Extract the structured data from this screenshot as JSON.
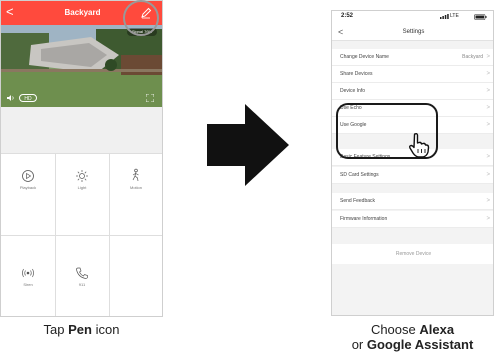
{
  "left_phone": {
    "title": "Backyard",
    "back_glyph": "<",
    "wifi_badge": "Signal 76%",
    "hd_label": "HD",
    "controls": [
      {
        "label": "Playback",
        "icon": "playback-icon"
      },
      {
        "label": "Light",
        "icon": "light-icon"
      },
      {
        "label": "Motion",
        "icon": "motion-icon"
      },
      {
        "label": "Siren",
        "icon": "siren-icon"
      },
      {
        "label": "911",
        "icon": "phone-icon"
      }
    ],
    "header_color": "#ff4a3d"
  },
  "right_phone": {
    "status_time": "2:52",
    "status_carrier": "LTE",
    "back_glyph": "<",
    "title": "Settings",
    "rows": [
      {
        "label": "Change Device Name",
        "value": "Backyard"
      },
      {
        "label": "Share Devices",
        "value": ""
      },
      {
        "label": "Device Info",
        "value": ""
      },
      {
        "label": "Use Echo",
        "value": ""
      },
      {
        "label": "Use Google",
        "value": ""
      },
      {
        "label": "Basic Feature Settings",
        "value": ""
      },
      {
        "label": "SD Card Settings",
        "value": ""
      },
      {
        "label": "Send Feedback",
        "value": ""
      },
      {
        "label": "Firmware Information",
        "value": ""
      }
    ],
    "remove_label": "Remove Device",
    "chevron": ">"
  },
  "captions": {
    "left_prefix": "Tap ",
    "left_bold": "Pen",
    "left_suffix": " icon",
    "right_line1_prefix": "Choose ",
    "right_line1_bold": "Alexa",
    "right_line2_prefix": "or ",
    "right_line2_bold": "Google Assistant"
  }
}
